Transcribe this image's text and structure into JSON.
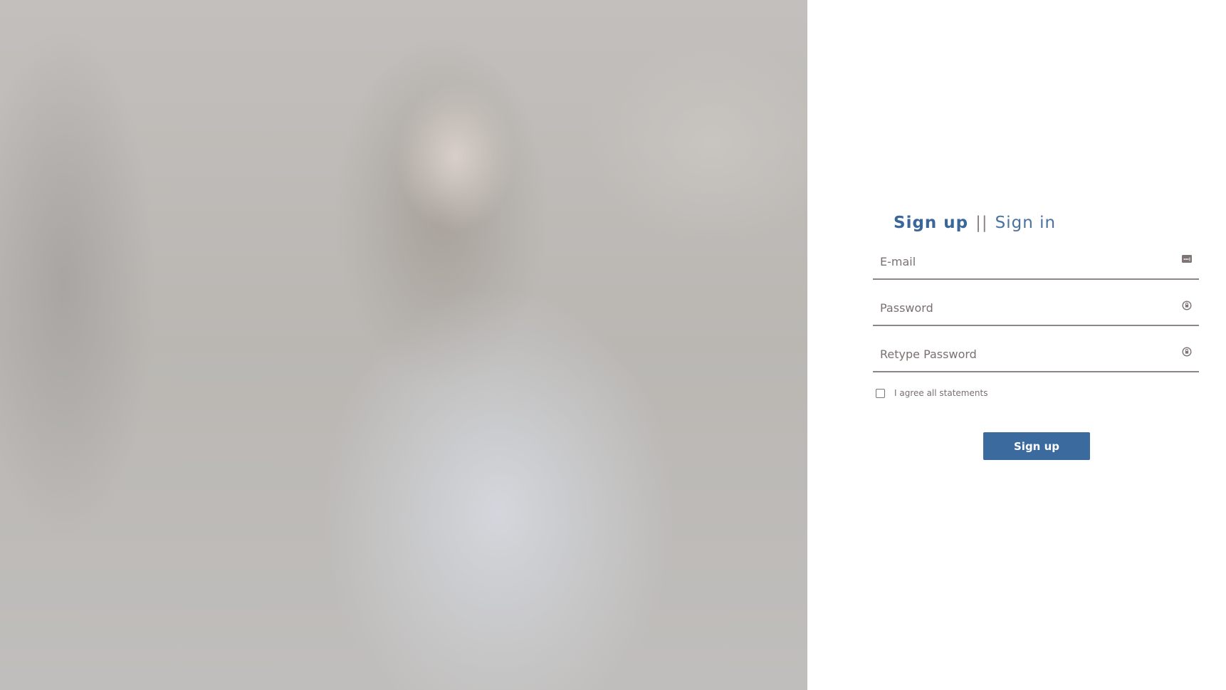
{
  "tabs": {
    "sign_up": "Sign up",
    "separator": "||",
    "sign_in": "Sign in"
  },
  "form": {
    "email_placeholder": "E-mail",
    "password_placeholder": "Password",
    "retype_placeholder": "Retype Password",
    "agree_label": "I agree all statements",
    "agree_checked": false,
    "submit_label": "Sign up"
  },
  "colors": {
    "accent": "#3a6a9e",
    "field_line": "#8c8686"
  },
  "icons": {
    "email": "email-card-icon",
    "password": "lock-icon",
    "retype": "lock-icon"
  }
}
